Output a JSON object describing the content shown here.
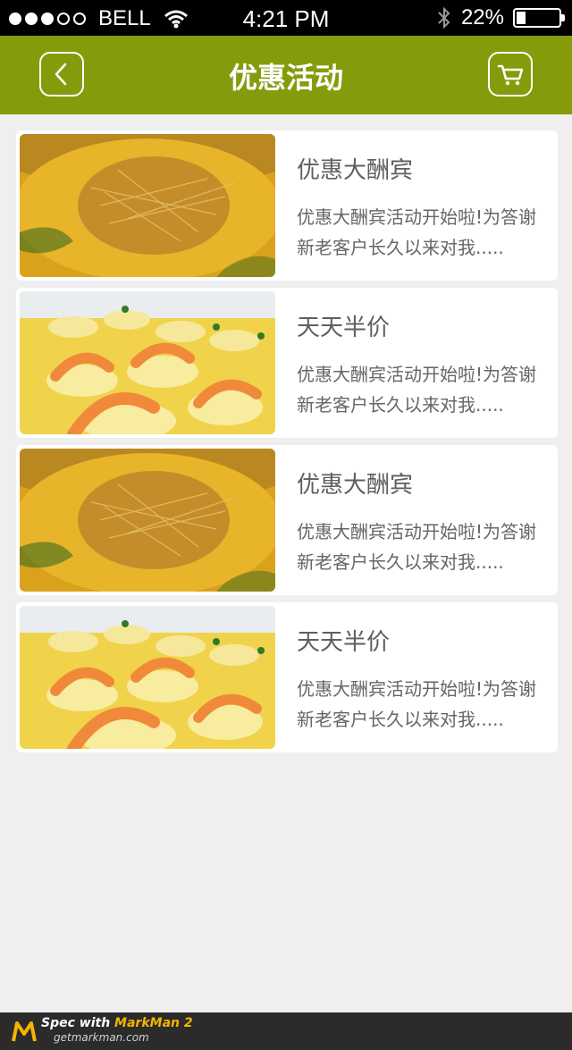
{
  "status_bar": {
    "carrier": "BELL",
    "time": "4:21 PM",
    "battery": "22%",
    "battery_level": 0.22,
    "signal_bars": 3,
    "signal_total": 5
  },
  "nav": {
    "title": "优惠活动",
    "back_icon": "chevron-left-icon",
    "cart_icon": "cart-icon"
  },
  "colors": {
    "nav_bg": "#849c0c",
    "title_text": "#605e5f",
    "desc_text": "#666666",
    "page_bg": "#efefef"
  },
  "promotions": [
    {
      "title": "优惠大酬宾",
      "desc": "优惠大酬宾活动开始啦!为答谢新老客户长久以来对我.....",
      "image": "noodle-soup"
    },
    {
      "title": "天天半价",
      "desc": "优惠大酬宾活动开始啦!为答谢新老客户长久以来对我.....",
      "image": "shrimp-tofu"
    },
    {
      "title": "优惠大酬宾",
      "desc": "优惠大酬宾活动开始啦!为答谢新老客户长久以来对我.....",
      "image": "noodle-soup"
    },
    {
      "title": "天天半价",
      "desc": "优惠大酬宾活动开始啦!为答谢新老客户长久以来对我.....",
      "image": "shrimp-tofu"
    }
  ],
  "footer": {
    "spec_prefix": "Spec with ",
    "brand": "MarkMan 2",
    "url": "getmarkman.com"
  }
}
